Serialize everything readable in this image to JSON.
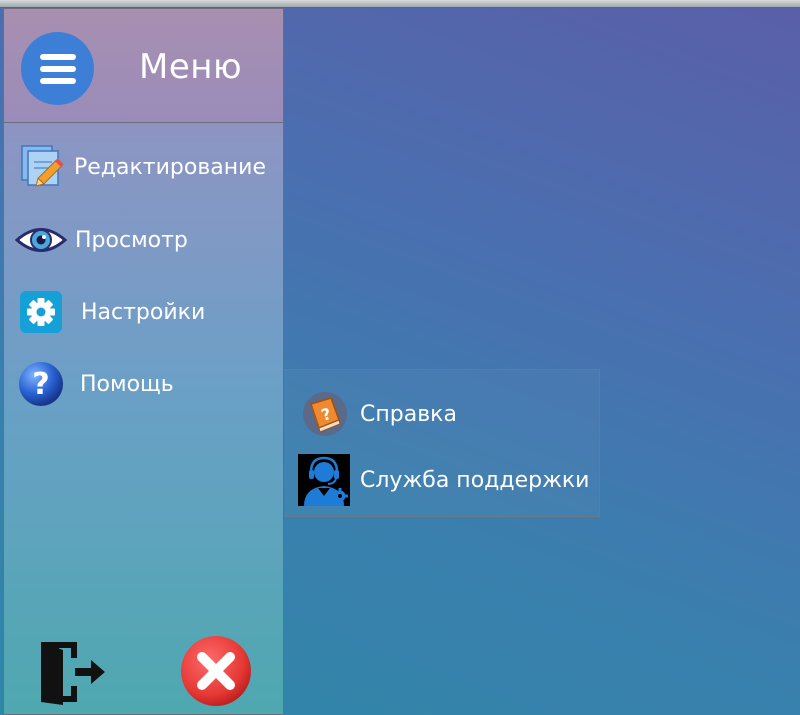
{
  "menu": {
    "title": "Меню",
    "items": [
      {
        "label": "Редактирование",
        "icon": "edit-document-icon"
      },
      {
        "label": "Просмотр",
        "icon": "eye-icon"
      },
      {
        "label": "Настройки",
        "icon": "gear-icon"
      },
      {
        "label": "Помощь",
        "icon": "help-question-icon"
      }
    ]
  },
  "submenu": {
    "items": [
      {
        "label": "Справка",
        "icon": "help-book-icon"
      },
      {
        "label": "Служба поддержки",
        "icon": "support-agent-icon"
      }
    ]
  },
  "footer": {
    "exit_icon": "exit-door-icon",
    "close_icon": "close-icon"
  },
  "colors": {
    "accent": "#3d7fd6",
    "close": "#e53935"
  }
}
